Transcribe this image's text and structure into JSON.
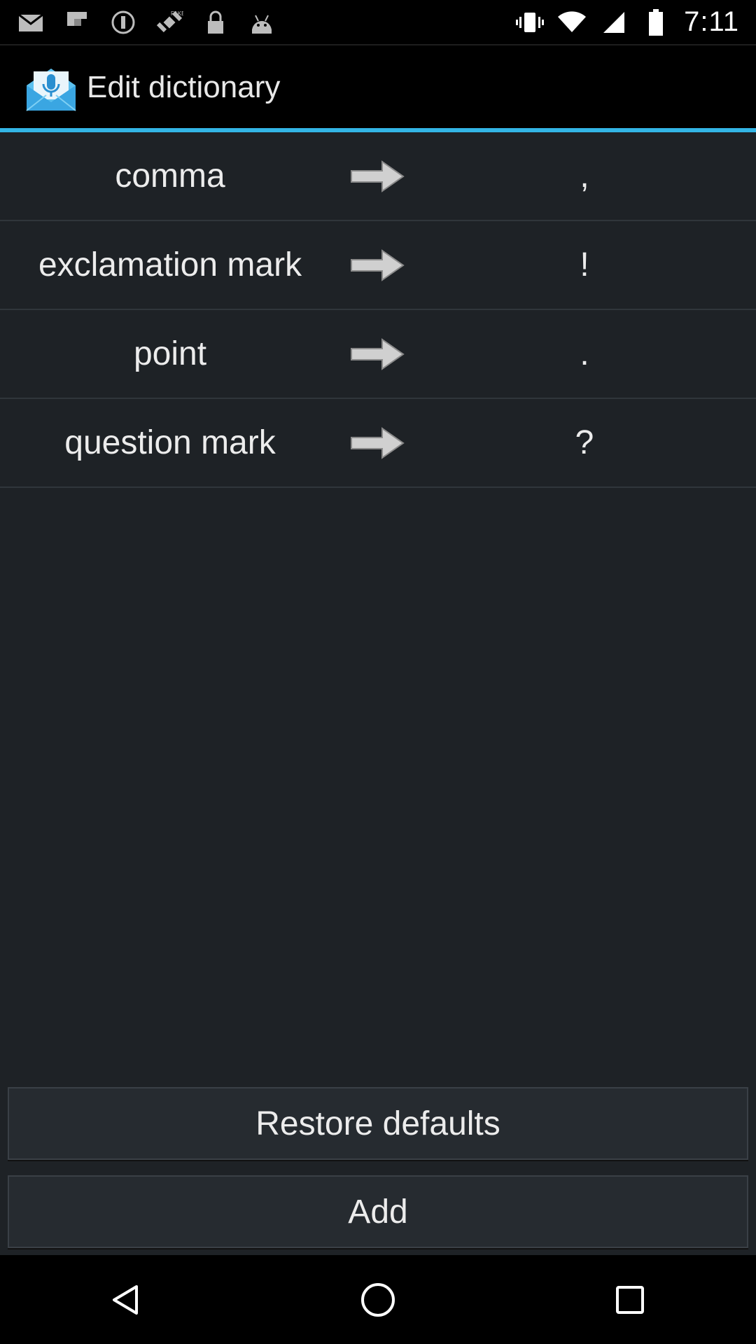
{
  "status_bar": {
    "time": "7:11",
    "left_icons": [
      "mail-icon",
      "flipboard-icon",
      "do-not-disturb-icon",
      "satellite-icon",
      "lock-icon",
      "android-icon"
    ],
    "right_icons": [
      "vibrate-icon",
      "wifi-icon",
      "signal-icon",
      "battery-icon"
    ]
  },
  "header": {
    "title": "Edit dictionary",
    "icon": "mail-microphone-icon",
    "accent_color": "#33b5e5"
  },
  "entries": [
    {
      "word": "comma",
      "symbol": ","
    },
    {
      "word": "exclamation mark",
      "symbol": "!"
    },
    {
      "word": "point",
      "symbol": "."
    },
    {
      "word": "question mark",
      "symbol": "?"
    }
  ],
  "buttons": {
    "restore_label": "Restore defaults",
    "add_label": "Add"
  },
  "nav_bar": {
    "icons": [
      "back-icon",
      "home-icon",
      "recents-icon"
    ]
  }
}
